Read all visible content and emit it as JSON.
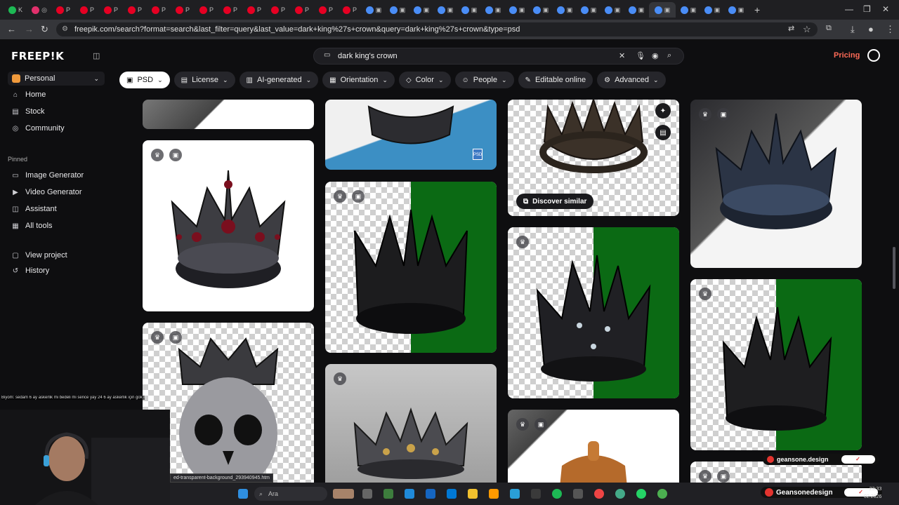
{
  "browser": {
    "url": "freepik.com/search?format=search&last_filter=query&last_value=dark+king%27s+crown&query=dark+king%27s+crown&type=psd",
    "tabs": [
      "K",
      "◎",
      "P",
      "P",
      "P",
      "P",
      "P",
      "P",
      "P",
      "P",
      "P",
      "P",
      "P",
      "P",
      "P",
      "▣",
      "▣",
      "▣",
      "▣",
      "▣",
      "▣",
      "▣",
      "▣",
      "▣",
      "▣",
      "▣",
      "▣",
      "▣",
      "▣",
      "▣",
      "▣"
    ],
    "new_tab": "+"
  },
  "header": {
    "logo": "FREEP!K",
    "search_value": "dark king's crown",
    "pricing_label": "Pricing"
  },
  "sidebar": {
    "workspace": "Personal",
    "items": [
      {
        "label": "Home",
        "icon": "home-icon"
      },
      {
        "label": "Stock",
        "icon": "stock-icon"
      },
      {
        "label": "Community",
        "icon": "globe-icon"
      }
    ],
    "pinned_label": "Pinned",
    "pinned": [
      {
        "label": "Image Generator",
        "icon": "image-generator-icon"
      },
      {
        "label": "Video Generator",
        "icon": "video-generator-icon"
      },
      {
        "label": "Assistant",
        "icon": "assistant-icon"
      },
      {
        "label": "All tools",
        "icon": "grid-icon"
      }
    ],
    "extra": [
      {
        "label": "View project",
        "icon": "folder-icon"
      },
      {
        "label": "History",
        "icon": "history-icon"
      }
    ]
  },
  "filters": [
    {
      "label": "PSD",
      "selected": true
    },
    {
      "label": "License"
    },
    {
      "label": "AI-generated"
    },
    {
      "label": "Orientation"
    },
    {
      "label": "Color"
    },
    {
      "label": "People"
    },
    {
      "label": "Editable online"
    },
    {
      "label": "Advanced"
    }
  ],
  "results": {
    "discover_label": "Discover similar"
  },
  "overlays": {
    "chat_line": "Biyom: sedam 6 ay askerlik mi bedeli mi sence yay 24 6 ay askerlik için gok mu",
    "status_url": "ed-transparent-background_293940945.htm",
    "taskbar_search": "Ara",
    "badge1": "geansone.design",
    "badge2": "Geansonedesign",
    "clock_time": "23:33",
    "clock_date": "02.2026"
  }
}
